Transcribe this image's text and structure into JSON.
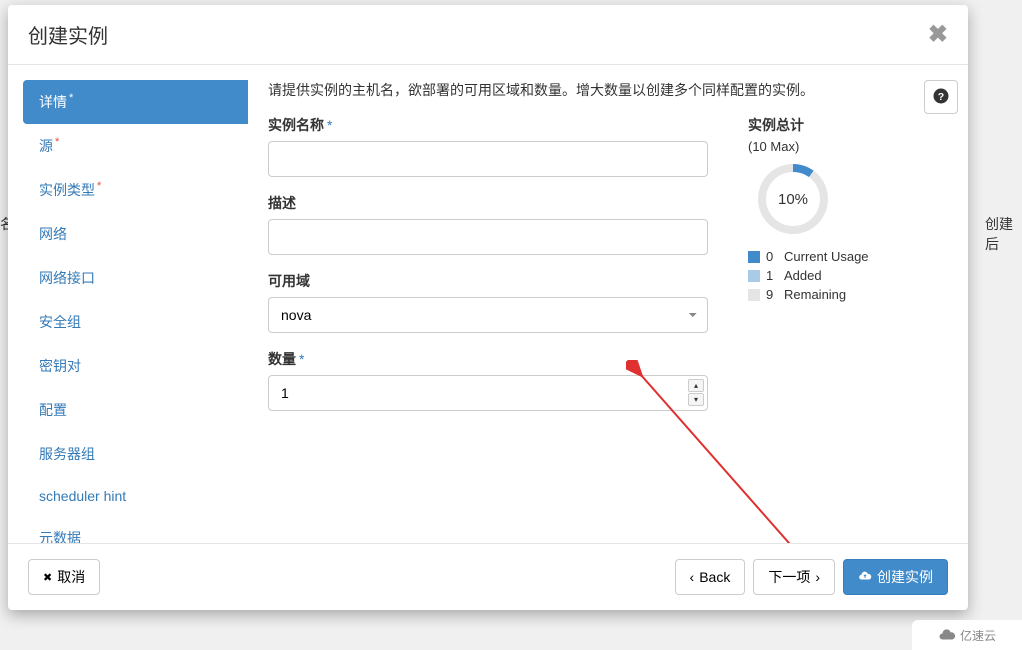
{
  "modal": {
    "title": "创建实例",
    "intro": "请提供实例的主机名，欲部署的可用区域和数量。增大数量以创建多个同样配置的实例。"
  },
  "sidebar": {
    "items": [
      {
        "label": "详情",
        "required": true
      },
      {
        "label": "源",
        "required": true
      },
      {
        "label": "实例类型",
        "required": true
      },
      {
        "label": "网络",
        "required": false
      },
      {
        "label": "网络接口",
        "required": false
      },
      {
        "label": "安全组",
        "required": false
      },
      {
        "label": "密钥对",
        "required": false
      },
      {
        "label": "配置",
        "required": false
      },
      {
        "label": "服务器组",
        "required": false
      },
      {
        "label": "scheduler hint",
        "required": false
      },
      {
        "label": "元数据",
        "required": false
      }
    ]
  },
  "form": {
    "name_label": "实例名称",
    "name_value": "",
    "desc_label": "描述",
    "desc_value": "",
    "az_label": "可用域",
    "az_value": "nova",
    "count_label": "数量",
    "count_value": "1"
  },
  "summary": {
    "title": "实例总计",
    "subtitle": "(10 Max)",
    "percent": "10%",
    "legend": [
      {
        "count": "0",
        "label": "Current Usage",
        "color": "#428bca"
      },
      {
        "count": "1",
        "label": "Added",
        "color": "#a9cbe8"
      },
      {
        "count": "9",
        "label": "Remaining",
        "color": "#e5e5e5"
      }
    ]
  },
  "footer": {
    "cancel": "取消",
    "back": "Back",
    "next": "下一项",
    "create": "创建实例"
  },
  "chart_data": {
    "type": "pie",
    "title": "实例总计",
    "values": [
      {
        "name": "Current Usage",
        "value": 0
      },
      {
        "name": "Added",
        "value": 1
      },
      {
        "name": "Remaining",
        "value": 9
      }
    ],
    "max": 10,
    "percent_label": "10%"
  },
  "watermark": "亿速云",
  "bg": {
    "col1": "名",
    "col2": "创建后"
  }
}
